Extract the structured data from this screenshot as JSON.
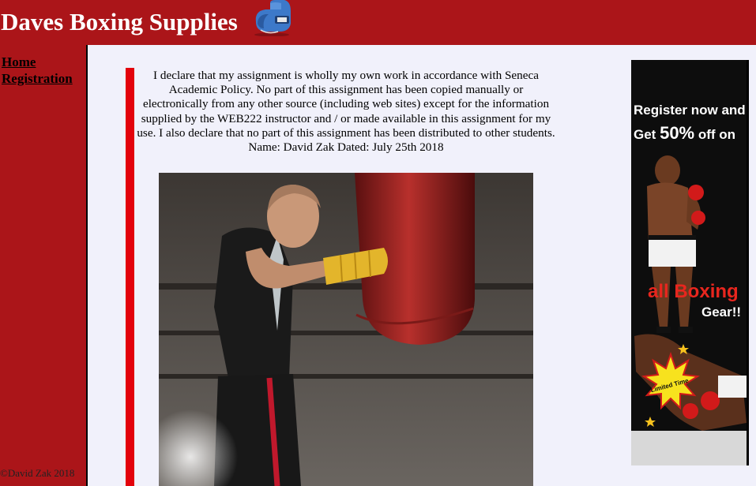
{
  "header": {
    "title": "Daves Boxing Supplies",
    "logo_icon": "boxing-glove-icon"
  },
  "nav": {
    "items": [
      {
        "label": "Home"
      },
      {
        "label": "Registration"
      }
    ]
  },
  "footer": {
    "text": "©David Zak 2018"
  },
  "main": {
    "declaration": "I declare that my assignment is wholly my own work in accordance with Seneca Academic Policy. No part of this assignment has been copied manually or electronically from any other source (including web sites) except for the information supplied by the WEB222 instructor and / or made available in this assignment for my use. I also declare that no part of this assignment has been distributed to other students. Name: David Zak Dated: July 25th 2018"
  },
  "ad": {
    "line1": "Register now and",
    "line2_prefix": "Get",
    "line2_highlight": "50%",
    "line2_suffix": "off on",
    "line3": "all Boxing",
    "line4": "Gear!!",
    "badge": "Limited Time"
  },
  "colors": {
    "brand_red": "#ab1519",
    "accent_red": "#e3020c",
    "content_bg": "#f1f1fb"
  }
}
